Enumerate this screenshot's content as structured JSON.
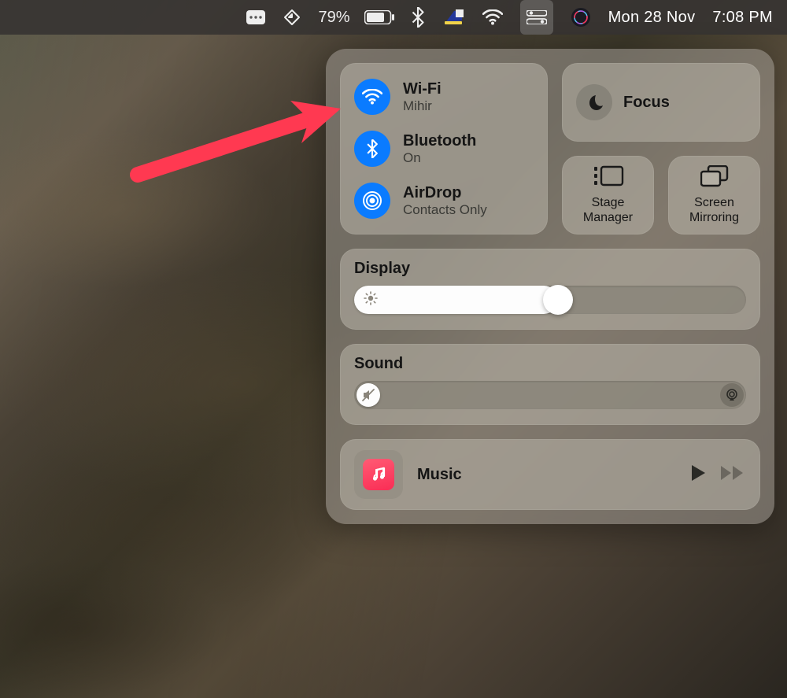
{
  "menubar": {
    "battery_percent": "79%",
    "date": "Mon 28 Nov",
    "time": "7:08 PM"
  },
  "control_center": {
    "wifi": {
      "title": "Wi-Fi",
      "subtitle": "Mihir"
    },
    "bluetooth": {
      "title": "Bluetooth",
      "subtitle": "On"
    },
    "airdrop": {
      "title": "AirDrop",
      "subtitle": "Contacts Only"
    },
    "focus": {
      "title": "Focus"
    },
    "stage_manager": {
      "line1": "Stage",
      "line2": "Manager"
    },
    "screen_mirroring": {
      "line1": "Screen",
      "line2": "Mirroring"
    },
    "display": {
      "title": "Display",
      "value_percent": 52
    },
    "sound": {
      "title": "Sound",
      "value_percent": 0
    },
    "music": {
      "title": "Music"
    }
  }
}
